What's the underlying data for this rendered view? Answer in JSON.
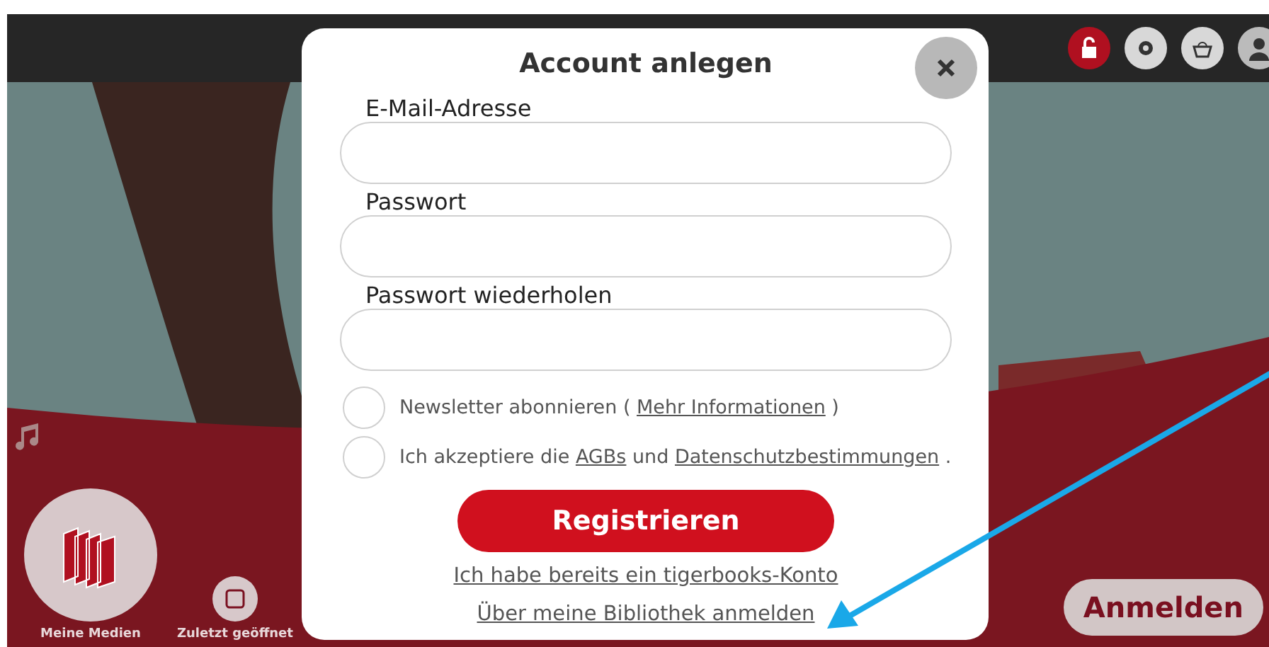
{
  "navigation": [
    {
      "kind": "large",
      "label": "Meine Medien"
    },
    {
      "kind": "small",
      "label": "Zuletzt geöffnet"
    }
  ],
  "login_button": "Anmelden",
  "dialog": {
    "title": "Account anlegen",
    "fields": [
      {
        "label": "E-Mail-Adresse"
      },
      {
        "label": "Passwort"
      },
      {
        "label": "Passwort wiederholen"
      }
    ],
    "checkboxes": [
      {
        "checked": false,
        "parts": [
          {
            "kind": "text",
            "text": "Newsletter abonnieren ("
          },
          {
            "kind": "link",
            "text": "Mehr Informationen"
          },
          {
            "kind": "text",
            "text": ")"
          }
        ]
      },
      {
        "checked": false,
        "parts": [
          {
            "kind": "text",
            "text": "Ich akzeptiere die"
          },
          {
            "kind": "link",
            "text": "AGBs"
          },
          {
            "kind": "text",
            "text": "und"
          },
          {
            "kind": "link",
            "text": "Datenschutzbestimmungen"
          },
          {
            "kind": "text",
            "text": "."
          }
        ]
      }
    ],
    "submit": "Registrieren",
    "links": [
      "Ich habe bereits ein tigerbooks-Konto",
      "Über meine Bibliothek anmelden"
    ]
  }
}
